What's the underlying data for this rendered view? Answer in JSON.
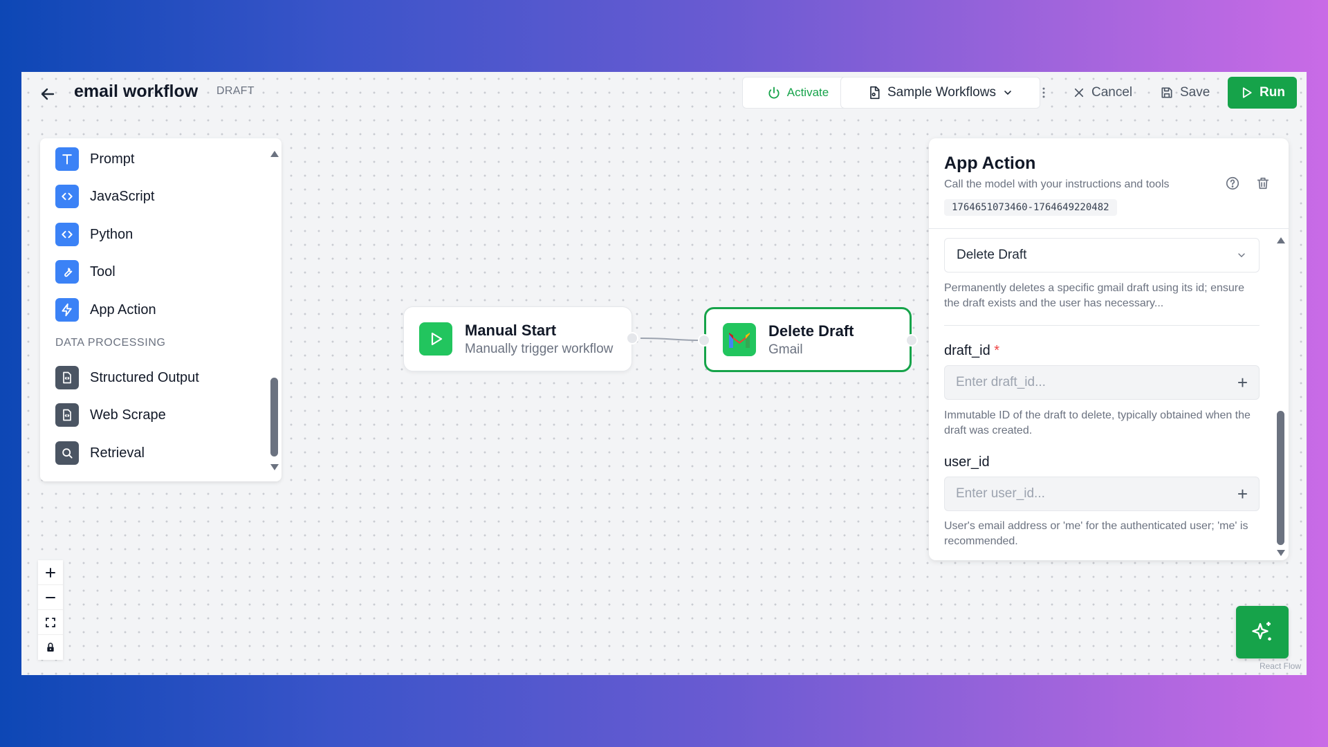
{
  "header": {
    "title": "email workflow",
    "badge": "DRAFT",
    "activate_label": "Activate",
    "samples_label": "Sample Workflows",
    "cancel_label": "Cancel",
    "save_label": "Save",
    "run_label": "Run"
  },
  "palette": {
    "items": [
      {
        "label": "Prompt",
        "icon": "text-icon"
      },
      {
        "label": "JavaScript",
        "icon": "code-icon"
      },
      {
        "label": "Python",
        "icon": "code-icon"
      },
      {
        "label": "Tool",
        "icon": "wrench-icon"
      },
      {
        "label": "App Action",
        "icon": "bolt-icon"
      }
    ],
    "section_label": "DATA PROCESSING",
    "data_items": [
      {
        "label": "Structured Output",
        "icon": "document-icon"
      },
      {
        "label": "Web Scrape",
        "icon": "document-icon"
      },
      {
        "label": "Retrieval",
        "icon": "search-icon"
      }
    ]
  },
  "nodes": {
    "manual": {
      "title": "Manual Start",
      "subtitle": "Manually trigger workflow"
    },
    "draft": {
      "title": "Delete Draft",
      "subtitle": "Gmail"
    }
  },
  "panel": {
    "title": "App Action",
    "subtitle": "Call the model with your instructions and tools",
    "node_id": "1764651073460-1764649220482",
    "action_value": "Delete Draft",
    "action_description": "Permanently deletes a specific gmail draft using its id; ensure the draft exists and the user has necessary...",
    "fields": [
      {
        "label": "draft_id",
        "required": "*",
        "placeholder": "Enter draft_id...",
        "help": "Immutable ID of the draft to delete, typically obtained when the draft was created."
      },
      {
        "label": "user_id",
        "required": "",
        "placeholder": "Enter user_id...",
        "help": "User's email address or 'me' for the authenticated user; 'me' is recommended."
      }
    ]
  },
  "attribution": "React Flow",
  "colors": {
    "accent_green": "#16a34a",
    "palette_blue": "#3b82f6",
    "palette_slate": "#4b5563"
  }
}
